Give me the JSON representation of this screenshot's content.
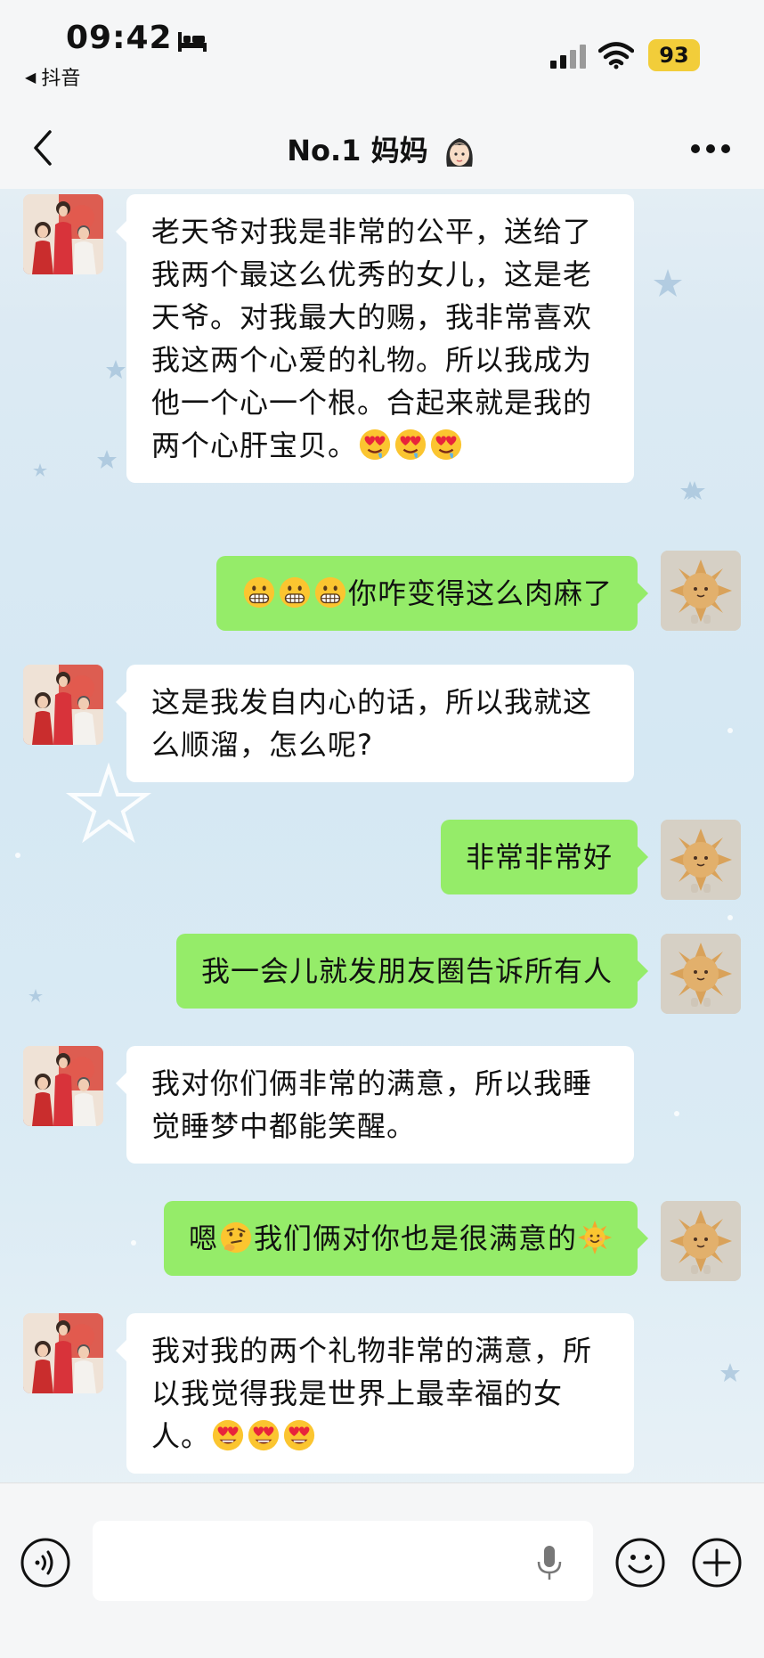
{
  "status_bar": {
    "time": "09:42",
    "back_app": "抖音",
    "battery": "93",
    "icons": [
      "bed-icon",
      "signal-icon",
      "wifi-icon",
      "battery-icon"
    ]
  },
  "header": {
    "title": "No.1 妈妈",
    "title_emoji": "woman-face-emoji",
    "icons": [
      "back-chevron-icon",
      "more-dots-icon"
    ]
  },
  "messages": [
    {
      "side": "left",
      "sender": "mom",
      "text": "老天爷对我是非常的公平，送给了我两个最这么优秀的女儿，这是老天爷。对我最大的赐，我非常喜欢我这两个心爱的礼物。所以我成为他一个心一个根。合起来就是我的两个心肝宝贝。",
      "emojis_after": [
        "drooling-heart-eyes-emoji",
        "drooling-heart-eyes-emoji",
        "drooling-heart-eyes-emoji"
      ]
    },
    {
      "side": "right",
      "sender": "me",
      "emojis_before": [
        "grimacing-emoji",
        "grimacing-emoji",
        "grimacing-emoji"
      ],
      "text": "你咋变得这么肉麻了"
    },
    {
      "side": "left",
      "sender": "mom",
      "text": "这是我发自内心的话，所以我就这么顺溜，怎么呢?"
    },
    {
      "side": "right",
      "sender": "me",
      "text": "非常非常好"
    },
    {
      "side": "right",
      "sender": "me",
      "text": "我一会儿就发朋友圈告诉所有人"
    },
    {
      "side": "left",
      "sender": "mom",
      "text": "我对你们俩非常的满意，所以我睡觉睡梦中都能笑醒。"
    },
    {
      "side": "right",
      "sender": "me",
      "text_a": "嗯",
      "emoji_mid": "thinking-emoji",
      "text_b": "我们俩对你也是很满意的",
      "emoji_end": "sun-face-emoji"
    },
    {
      "side": "left",
      "sender": "mom",
      "text": "我对我的两个礼物非常的满意，所以我觉得我是世界上最幸福的女人。",
      "emojis_after": [
        "heart-eyes-emoji",
        "heart-eyes-emoji",
        "heart-eyes-emoji"
      ]
    }
  ],
  "input_bar": {
    "placeholder": "",
    "icons": [
      "voice-icon",
      "mic-icon",
      "emoji-icon",
      "plus-icon"
    ]
  },
  "colors": {
    "bubble_right": "#95ec69",
    "bubble_left": "#ffffff",
    "bar_bg": "#f5f6f7",
    "battery": "#f2cd3a"
  }
}
